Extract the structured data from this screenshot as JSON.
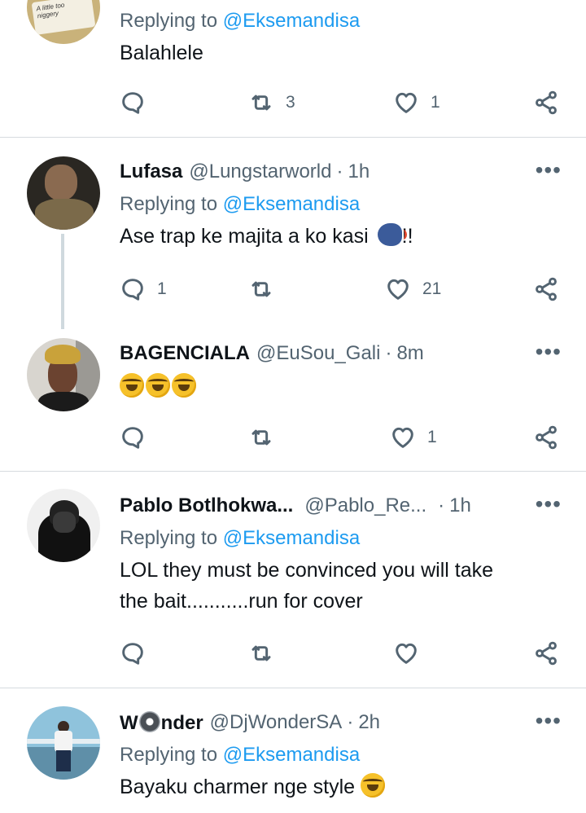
{
  "tweets": [
    {
      "reply_prefix": "Replying to",
      "reply_to": "@Eksemandisa",
      "text": "Balahlele",
      "avatar_caption": "A little too niggery",
      "actions": {
        "reply": "",
        "retweet": "3",
        "like": "1"
      }
    },
    {
      "name": "Lufasa",
      "handle": "@Lungstarworld",
      "dot": "·",
      "time": "1h",
      "reply_prefix": "Replying to",
      "reply_to": "@Eksemandisa",
      "text": "Ase trap ke majita a ko kasi",
      "text_suffix": "!!",
      "actions": {
        "reply": "1",
        "retweet": "",
        "like": "21"
      }
    },
    {
      "name": "BAGENCIALA",
      "handle": "@EuSou_Gali",
      "dot": "·",
      "time": "8m",
      "actions": {
        "reply": "",
        "retweet": "",
        "like": "1"
      }
    },
    {
      "name": "Pablo Botlhokwa...",
      "handle": "@Pablo_Re...",
      "dot": "·",
      "time": "1h",
      "reply_prefix": "Replying to",
      "reply_to": "@Eksemandisa",
      "text_line1": "LOL they must be convinced you will take",
      "text_line2": "the bait...........run for cover",
      "actions": {
        "reply": "",
        "retweet": "",
        "like": ""
      }
    },
    {
      "name_start": "W",
      "name_end": "nder",
      "handle": "@DjWonderSA",
      "dot": "·",
      "time": "2h",
      "reply_prefix": "Replying to",
      "reply_to": "@Eksemandisa",
      "text": "Bayaku charmer nge style"
    }
  ],
  "more_label": "•••",
  "icons": {
    "reply": "reply-icon",
    "retweet": "retweet-icon",
    "like": "heart-icon",
    "share": "share-icon",
    "more": "more-options-icon"
  },
  "colors": {
    "mention": "#1d9bf0",
    "secondary_text": "#536471",
    "divider": "#d6dbdf",
    "thread_line": "#cfd9de"
  }
}
